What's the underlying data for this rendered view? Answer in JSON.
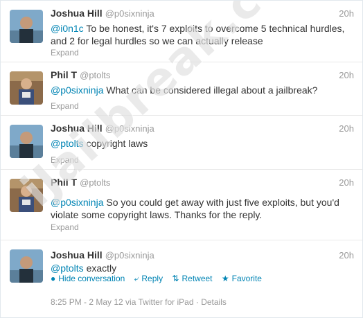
{
  "tweets": [
    {
      "name": "Joshua Hill",
      "handle": "@p0sixninja",
      "time": "20h",
      "mention": "@i0n1c",
      "text": " To be honest, it's 7 exploits to overcome 5 technical hurdles, and 2 for legal hurdles so we can actually release",
      "expand": "Expand"
    },
    {
      "name": "Phil T",
      "handle": "@ptolts",
      "time": "20h",
      "mention": "@p0sixninja",
      "text": " What can be considered illegal about a jailbreak?",
      "expand": "Expand"
    },
    {
      "name": "Joshua Hill",
      "handle": "@p0sixninja",
      "time": "20h",
      "mention": "@ptolts",
      "text": " copyright laws",
      "expand": "Expand"
    },
    {
      "name": "Phil T",
      "handle": "@ptolts",
      "time": "20h",
      "mention": "@p0sixninja",
      "text": " So you could get away with just five exploits, but you'd violate some copyright laws. Thanks for the reply.",
      "expand": "Expand"
    },
    {
      "name": "Joshua Hill",
      "handle": "@p0sixninja",
      "time": "20h",
      "mention": "@ptolts",
      "text": " exactly",
      "actions": {
        "hide": "Hide conversation",
        "reply": "Reply",
        "retweet": "Retweet",
        "favorite": "Favorite"
      },
      "meta": "8:25 PM - 2 May 12 via Twitter for iPad · Details"
    }
  ],
  "watermark": "iJailbreak.com",
  "colors": {
    "link": "#0084b4",
    "muted": "#999999",
    "text": "#333333"
  }
}
